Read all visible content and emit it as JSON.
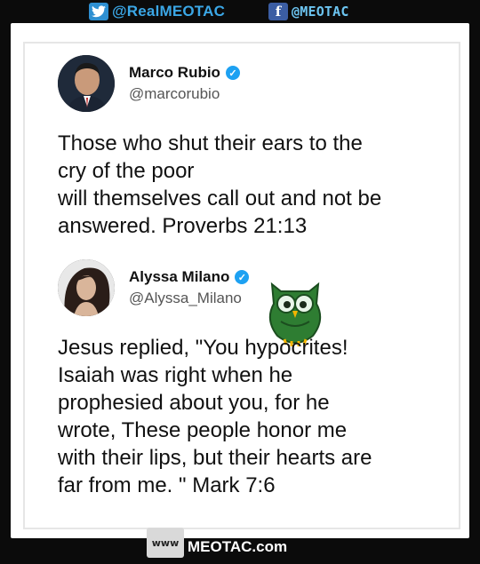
{
  "header": {
    "twitter_handle": "@RealMEOTAC",
    "facebook_handle": "@MEOTAC",
    "twitter_icon": "twitter-bird-icon",
    "facebook_icon": "facebook-f-icon"
  },
  "tweet1": {
    "name": "Marco Rubio",
    "handle": "@marcorubio",
    "text_lines": [
      "Those who shut their ears to the",
      "cry of the poor",
      "will themselves call out and not be",
      "answered. Proverbs 21:13"
    ]
  },
  "tweet2": {
    "name": "Alyssa Milano",
    "handle": "@Alyssa_Milano",
    "text_lines": [
      "Jesus replied, \"You hypocrites!",
      "Isaiah was right when he",
      "prophesied about you, for he",
      "wrote, These people honor me",
      "with their lips, but their hearts are",
      "far from me. \"  Mark 7:6"
    ]
  },
  "footer": {
    "www_label": "www",
    "brand": "MEOTAC.com"
  },
  "colors": {
    "verified": "#1da1f2",
    "twitter": "#2e8fd1",
    "facebook": "#3b5da3",
    "owl": "#2e7d32"
  }
}
